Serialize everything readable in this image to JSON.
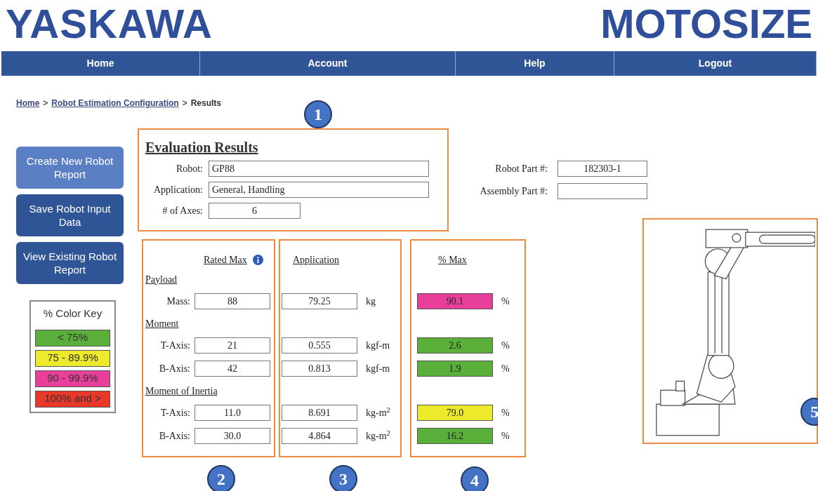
{
  "header": {
    "logo": "YASKAWA",
    "product": "MOTOSIZE"
  },
  "nav": [
    {
      "label": "Home"
    },
    {
      "label": "Account"
    },
    {
      "label": "Help"
    },
    {
      "label": "Logout"
    }
  ],
  "breadcrumb": {
    "separator": ">",
    "items": [
      {
        "label": "Home",
        "kind": "link"
      },
      {
        "label": "Robot Estimation Configuration",
        "kind": "link"
      },
      {
        "label": "Results",
        "kind": "current"
      }
    ]
  },
  "actions": [
    {
      "label": "Create New Robot Report",
      "highlighted": true
    },
    {
      "label": "Save Robot Input Data",
      "highlighted": false
    },
    {
      "label": "View Existing Robot Report",
      "highlighted": false
    }
  ],
  "color_key": {
    "title": "% Color Key",
    "items": [
      {
        "label": "< 75%",
        "color": "#5aae3a"
      },
      {
        "label": "75 - 89.9%",
        "color": "#ecea2a"
      },
      {
        "label": "90 - 99.9%",
        "color": "#e8409a"
      },
      {
        "label": "100% and >",
        "color": "#e8382a"
      }
    ]
  },
  "evaluation": {
    "title": "Evaluation Results",
    "fields": [
      {
        "label": "Robot:",
        "value": "GP88",
        "kind": "wide"
      },
      {
        "label": "Application:",
        "value": "General, Handling",
        "kind": "wide"
      },
      {
        "label": "# of Axes:",
        "value": "6",
        "kind": "short"
      }
    ],
    "part_fields": [
      {
        "label": "Robot Part #:",
        "value": "182303-1"
      },
      {
        "label": "Assembly Part #:"
      }
    ]
  },
  "results": {
    "rated_header": "Rated Max",
    "application_header": "Application",
    "percent_header": "% Max",
    "rows": [
      {
        "kind": "section",
        "label": "Payload"
      },
      {
        "kind": "item",
        "label": "Mass:",
        "rated": "88",
        "application": "79.25",
        "unit": "kg",
        "percent": "90.1",
        "percent_unit": "%",
        "color": "#e8409a"
      },
      {
        "kind": "section",
        "label": "Moment"
      },
      {
        "kind": "item",
        "label": "T-Axis:",
        "rated": "21",
        "application": "0.555",
        "unit": "kgf-m",
        "percent": "2.6",
        "percent_unit": "%",
        "color": "#5aae3a"
      },
      {
        "kind": "item",
        "label": "B-Axis:",
        "rated": "42",
        "application": "0.813",
        "unit": "kgf-m",
        "percent": "1.9",
        "percent_unit": "%",
        "color": "#5aae3a"
      },
      {
        "kind": "section",
        "label": "Moment of Inertia"
      },
      {
        "kind": "item",
        "label": "T-Axis:",
        "rated": "11.0",
        "application": "8.691",
        "unit": "kg-m$^{2}$",
        "percent": "79.0",
        "percent_unit": "%",
        "color": "#ecea2a"
      },
      {
        "kind": "item",
        "label": "B-Axis:",
        "rated": "30.0",
        "application": "4.864",
        "unit": "kg-m$^{2}$",
        "percent": "16.2",
        "percent_unit": "%",
        "color": "#5aae3a"
      }
    ]
  },
  "callouts": [
    "1",
    "2",
    "3",
    "4",
    "5"
  ]
}
